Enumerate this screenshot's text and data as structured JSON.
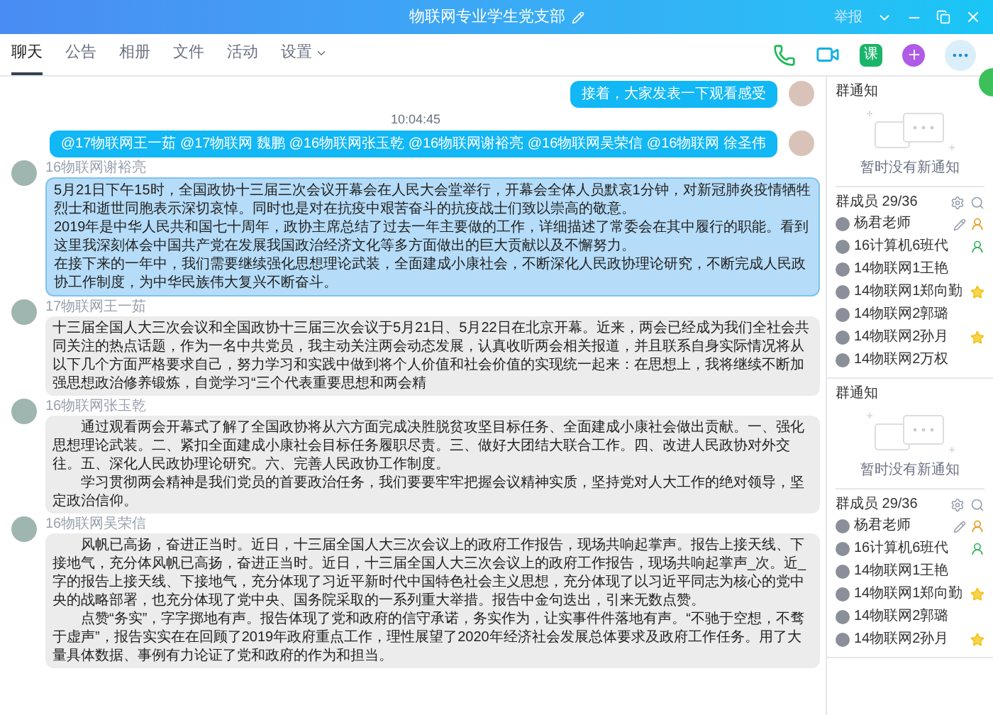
{
  "window": {
    "title": "物联网专业学生党支部",
    "report": "举报"
  },
  "tabs": [
    {
      "label": "聊天",
      "selected": true,
      "dropdown": false
    },
    {
      "label": "公告",
      "selected": false,
      "dropdown": false
    },
    {
      "label": "相册",
      "selected": false,
      "dropdown": false
    },
    {
      "label": "文件",
      "selected": false,
      "dropdown": false
    },
    {
      "label": "活动",
      "selected": false,
      "dropdown": false
    },
    {
      "label": "设置",
      "selected": false,
      "dropdown": true
    }
  ],
  "toolbar": [
    {
      "kind": "phone"
    },
    {
      "kind": "video"
    },
    {
      "kind": "lesson",
      "label": "课"
    },
    {
      "kind": "app"
    },
    {
      "kind": "more"
    }
  ],
  "messages": [
    {
      "kind": "self",
      "paragraphs": [
        "接着，大家发表一下观看感受"
      ]
    },
    {
      "kind": "time",
      "text": "10:04:45"
    },
    {
      "kind": "self",
      "paragraphs": [
        "@17物联网王一茹 @17物联网 魏鹏 @16物联网张玉乾 @16物联网谢裕亮 @16物联网吴荣信 @16物联网 徐圣伟"
      ]
    },
    {
      "kind": "other",
      "sender": "16物联网谢裕亮",
      "highlight": true,
      "indent": false,
      "paragraphs": [
        "5月21日下午15时，全国政协十三届三次会议开幕会在人民大会堂举行，开幕会全体人员默哀1分钟，对新冠肺炎疫情牺牲烈士和逝世同胞表示深切哀悼。同时也是对在抗疫中艰苦奋斗的抗疫战士们致以崇高的敬意。",
        "2019年是中华人民共和国七十周年，政协主席总结了过去一年主要做的工作，详细描述了常委会在其中履行的职能。看到这里我深刻体会中国共产党在发展我国政治经济文化等多方面做出的巨大贡献以及不懈努力。",
        "在接下来的一年中，我们需要继续强化思想理论武装，全面建成小康社会，不断深化人民政协理论研究，不断完成人民政协工作制度，为中华民族伟大复兴不断奋斗。"
      ]
    },
    {
      "kind": "other",
      "sender": "17物联网王一茹",
      "highlight": false,
      "indent": false,
      "paragraphs": [
        "十三届全国人大三次会议和全国政协十三届三次会议于5月21日、5月22日在北京开幕。近来，两会已经成为我们全社会共同关注的热点话题，作为一名中共党员，我主动关注两会动态发展，认真收听两会相关报道，并且联系自身实际情况将从以下几个方面严格要求自己，努力学习和实践中做到将个人价值和社会价值的实现统一起来：在思想上，我将继续不断加强思想政治修养锻炼，自觉学习“三个代表重要思想和两会精"
      ]
    },
    {
      "kind": "other",
      "sender": "16物联网张玉乾",
      "highlight": false,
      "indent": true,
      "paragraphs": [
        "通过观看两会开幕式了解了全国政协将从六方面完成决胜脱贫攻坚目标任务、全面建成小康社会做出贡献。一、强化思想理论武装。二、紧扣全面建成小康社会目标任务履职尽责。三、做好大团结大联合工作。四、改进人民政协对外交往。五、深化人民政协理论研究。六、完善人民政协工作制度。",
        "学习贯彻两会精神是我们党员的首要政治任务，我们要要牢牢把握会议精神实质，坚持党对人大工作的绝对领导，坚定政治信仰。"
      ]
    },
    {
      "kind": "other",
      "sender": "16物联网吴荣信",
      "highlight": false,
      "indent": true,
      "paragraphs": [
        "风帆已高扬，奋进正当时。近日，十三届全国人大三次会议上的政府工作报告，现场共响起掌声。报告上接天线、下接地气，充分体风帆已高扬，奋进正当时。近日，十三届全国人大三次会议上的政府工作报告，现场共响起掌声_次。近_字的报告上接天线、下接地气，充分体现了习近平新时代中国特色社会主义思想，充分体现了以习近平同志为核心的党中央的战略部署，也充分体现了党中央、国务院采取的一系列重大举措。报告中金句迭出，引来无数点赞。",
        "点赞“务实”，字字掷地有声。报告体现了党和政府的信守承诺，务实作为，让实事件件落地有声。“不驰于空想，不骛于虚声”，报告实实在在回顾了2019年政府重点工作，理性展望了2020年经济社会发展总体要求及政府工作任务。用了大量具体数据、事例有力论证了党和政府的作为和担当。"
      ]
    }
  ],
  "sidebar_panels": [
    {
      "notice_title": "群通知",
      "notice_empty": "暂时没有新通知",
      "members_title": "群成员 29/36",
      "members": [
        {
          "name": "杨君老师",
          "editable": true,
          "admin": true,
          "starred": false
        },
        {
          "name": "16计算机6班代",
          "editable": false,
          "admin": true,
          "starred": false
        },
        {
          "name": "14物联网1王艳",
          "editable": false,
          "admin": false,
          "starred": false
        },
        {
          "name": "14物联网1郑向勤",
          "editable": false,
          "admin": false,
          "starred": true
        },
        {
          "name": "14物联网2郭璐",
          "editable": false,
          "admin": false,
          "starred": false
        },
        {
          "name": "14物联网2孙月",
          "editable": false,
          "admin": false,
          "starred": true
        },
        {
          "name": "14物联网2万权",
          "editable": false,
          "admin": false,
          "starred": false
        }
      ]
    },
    {
      "notice_title": "群通知",
      "notice_empty": "暂时没有新通知",
      "members_title": "群成员 29/36",
      "members": [
        {
          "name": "杨君老师",
          "editable": true,
          "admin": true,
          "starred": false
        },
        {
          "name": "16计算机6班代",
          "editable": false,
          "admin": true,
          "starred": false
        },
        {
          "name": "14物联网1王艳",
          "editable": false,
          "admin": false,
          "starred": false
        },
        {
          "name": "14物联网1郑向勤",
          "editable": false,
          "admin": false,
          "starred": true
        },
        {
          "name": "14物联网2郭璐",
          "editable": false,
          "admin": false,
          "starred": false
        },
        {
          "name": "14物联网2孙月",
          "editable": false,
          "admin": false,
          "starred": true
        }
      ]
    }
  ]
}
